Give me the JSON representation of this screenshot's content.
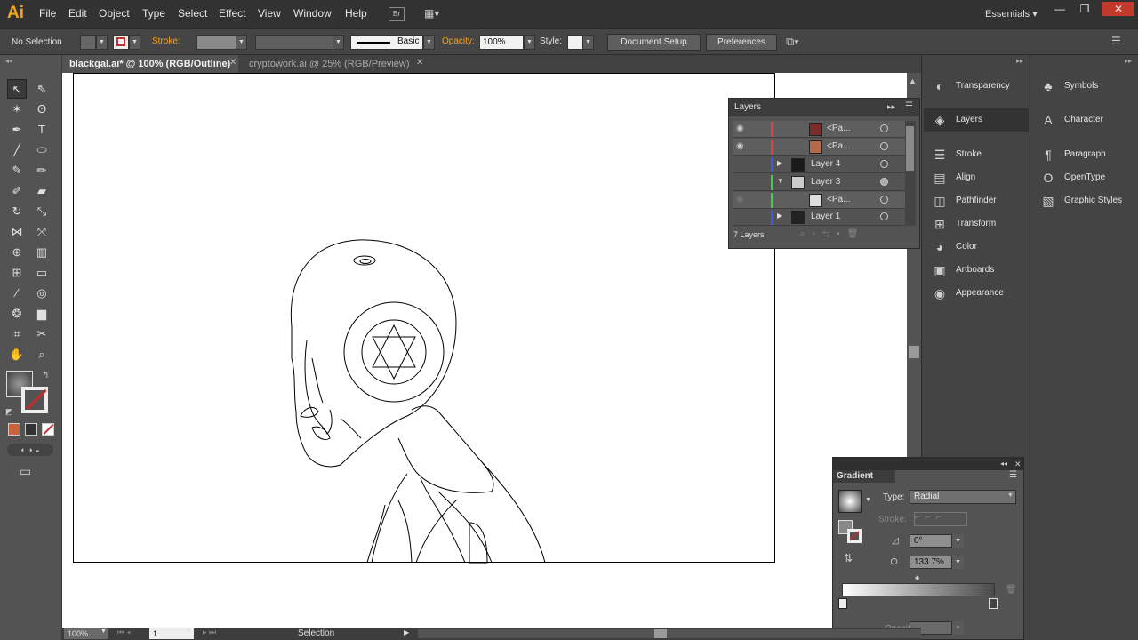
{
  "app": {
    "logo": "Ai",
    "workspace": "Essentials ▾"
  },
  "menu": [
    "File",
    "Edit",
    "Object",
    "Type",
    "Select",
    "Effect",
    "View",
    "Window",
    "Help"
  ],
  "window_controls": {
    "minimize": "—",
    "restore": "❐",
    "close": "✕"
  },
  "control_bar": {
    "selection": "No Selection",
    "stroke_label": "Stroke:",
    "brush_label": "Basic",
    "opacity_label": "Opacity:",
    "opacity_value": "100%",
    "style_label": "Style:",
    "document_setup": "Document Setup",
    "preferences": "Preferences"
  },
  "tabs": [
    {
      "label": "blackgal.ai* @ 100% (RGB/Outline)",
      "active": true
    },
    {
      "label": "cryptowork.ai @ 25% (RGB/Preview)",
      "active": false
    }
  ],
  "layers_panel": {
    "title": "Layers",
    "rows": [
      {
        "name": "<Pa...",
        "color": "#e04040",
        "visible": true,
        "indent": 2,
        "thumb": "#7a2b2b"
      },
      {
        "name": "<Pa...",
        "color": "#e04040",
        "visible": true,
        "indent": 2,
        "thumb": "#b46a4a"
      },
      {
        "name": "Layer 4",
        "color": "#3a5ae0",
        "visible": false,
        "indent": 1,
        "thumb": "#1a1a1a",
        "expander": "▶"
      },
      {
        "name": "Layer 3",
        "color": "#3ad048",
        "visible": false,
        "indent": 1,
        "thumb": "#cccccc",
        "expander": "▼"
      },
      {
        "name": "<Pa...",
        "color": "#3ad048",
        "visible": false,
        "indent": 2,
        "thumb": "#dddddd"
      },
      {
        "name": "Layer 1",
        "color": "#3a5ae0",
        "visible": false,
        "indent": 1,
        "thumb": "#222222",
        "expander": "▶"
      }
    ],
    "count": "7 Layers"
  },
  "dock_left": [
    {
      "label": "Transparency",
      "icon": "◐"
    },
    {
      "label": "Layers",
      "icon": "◈"
    },
    {
      "label": "Stroke",
      "icon": "☰"
    },
    {
      "label": "Align",
      "icon": "▤"
    },
    {
      "label": "Pathfinder",
      "icon": "◫"
    },
    {
      "label": "Transform",
      "icon": "⊞"
    },
    {
      "label": "Color",
      "icon": "◕"
    },
    {
      "label": "Artboards",
      "icon": "▣"
    },
    {
      "label": "Appearance",
      "icon": "◉"
    }
  ],
  "dock_right": [
    {
      "label": "Symbols",
      "icon": "♣"
    },
    {
      "label": "Character",
      "icon": "A"
    },
    {
      "label": "Paragraph",
      "icon": "¶"
    },
    {
      "label": "OpenType",
      "icon": "O"
    },
    {
      "label": "Graphic Styles",
      "icon": "▧"
    }
  ],
  "gradient_panel": {
    "title": "Gradient",
    "type_label": "Type:",
    "type_value": "Radial",
    "stroke_label": "Stroke:",
    "angle_value": "0°",
    "aspect_value": "133.7%",
    "opacity_label": "Opacity:"
  },
  "status": {
    "zoom": "100%",
    "artboard": "1",
    "mode": "Selection"
  }
}
